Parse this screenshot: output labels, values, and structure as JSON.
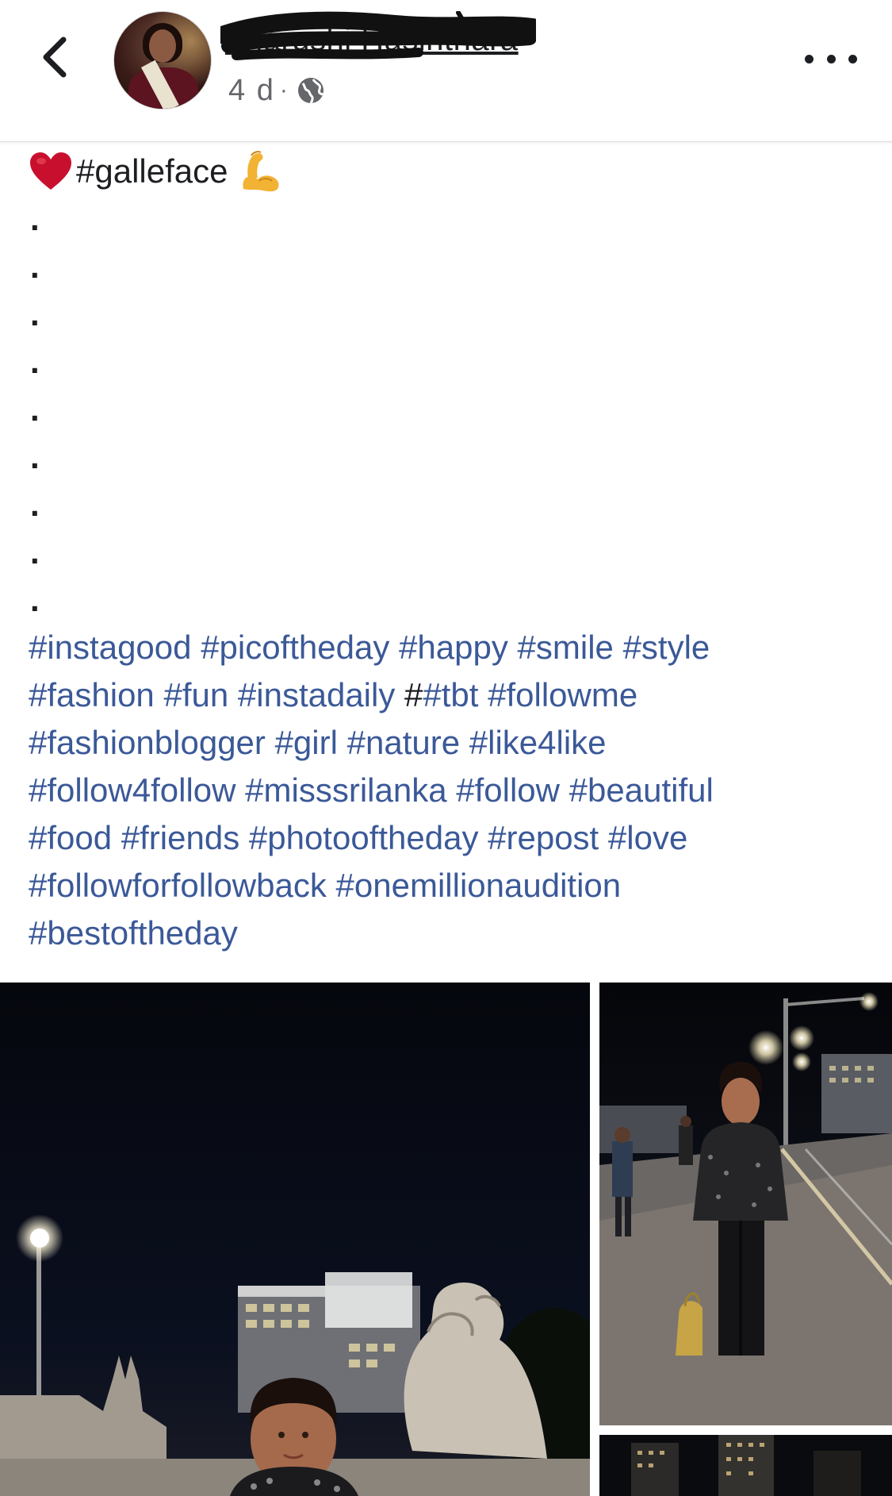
{
  "header": {
    "author_name": "Tharushi Hasinthara",
    "timestamp": "4 d",
    "separator": "·",
    "privacy_icon": "globe-icon",
    "back_icon": "chevron-left-icon",
    "more_icon": "more-dots-icon"
  },
  "post": {
    "first_line": {
      "prefix_emoji": "red-heart-icon",
      "text": "#galleface",
      "suffix_emoji": "flexed-biceps-icon"
    },
    "dots": [
      ".",
      ".",
      ".",
      ".",
      ".",
      ".",
      ".",
      ".",
      "."
    ],
    "hashtags": [
      "#instagood",
      "#picoftheday",
      "#happy",
      "#smile",
      "#style",
      "#fashion",
      "#fun",
      "#instadaily",
      "#",
      "#tbt",
      "#followme",
      "#fashionblogger",
      "#girl",
      "#nature",
      "#like4like",
      "#follow4follow",
      "#misssrilanka",
      "#follow",
      "#beautiful",
      "#food",
      "#friends",
      "#photooftheday",
      "#repost",
      "#love",
      "#followforfollowback",
      "#onemillionaudition",
      "#bestoftheday"
    ]
  },
  "photos": {
    "main": "photo-galle-face-lion-statue",
    "side_top": "photo-promenade-night-street",
    "side_bottom": "photo-city-buildings-night"
  },
  "colors": {
    "hashtag": "#3b5998",
    "text": "#1c1e21",
    "meta": "#65676b",
    "divider": "#dcdcdc"
  }
}
